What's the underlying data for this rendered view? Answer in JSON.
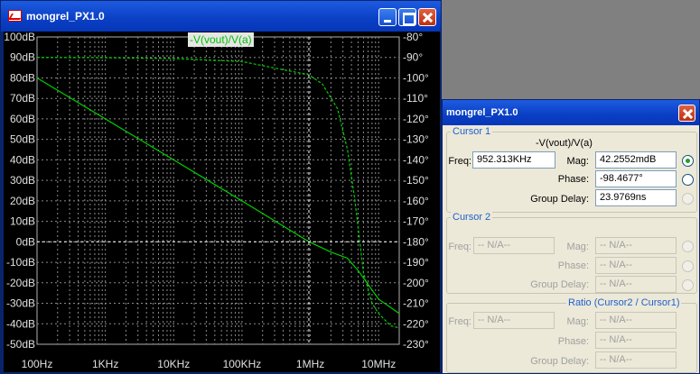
{
  "plot_window": {
    "title": "mongrel_PX1.0",
    "trace_label": "-V(vout)/V(a)"
  },
  "chart_data": {
    "type": "line",
    "x_scale": "log",
    "x_range_hz": [
      100,
      20000000
    ],
    "x_ticks": [
      "100Hz",
      "1KHz",
      "10KHz",
      "100KHz",
      "1MHz",
      "10MHz"
    ],
    "y_left_label_ticks": [
      "100dB",
      "90dB",
      "80dB",
      "70dB",
      "60dB",
      "50dB",
      "40dB",
      "30dB",
      "20dB",
      "10dB",
      "0dB",
      "-10dB",
      "-20dB",
      "-30dB",
      "-40dB",
      "-50dB"
    ],
    "y_left_range_db": [
      -50,
      100
    ],
    "y_right_label_ticks": [
      "-80°",
      "-90°",
      "-100°",
      "-110°",
      "-120°",
      "-130°",
      "-140°",
      "-150°",
      "-160°",
      "-170°",
      "-180°",
      "-190°",
      "-200°",
      "-210°",
      "-220°",
      "-230°"
    ],
    "y_right_range_deg": [
      -230,
      -80
    ],
    "grid": true,
    "trace_color": "#00d000",
    "series": [
      {
        "name": "-V(vout)/V(a)",
        "axis": "magnitude_db",
        "style": "solid",
        "x": [
          100,
          1000,
          10000,
          100000,
          952313,
          2000000,
          3500000,
          5000000,
          10000000,
          20000000
        ],
        "y": [
          80,
          60,
          40,
          20,
          0.042,
          -5,
          -8,
          -14,
          -28,
          -35
        ]
      },
      {
        "name": "-V(vout)/V(a)",
        "axis": "phase_deg",
        "style": "dashed",
        "x": [
          100,
          1000,
          10000,
          100000,
          952313,
          1500000,
          2500000,
          3500000,
          4500000,
          6000000,
          8000000,
          10000000,
          15000000,
          20000000
        ],
        "y": [
          -90,
          -90.1,
          -90.5,
          -92,
          -98.47,
          -103,
          -115,
          -135,
          -160,
          -195,
          -210,
          -215,
          -221,
          -222
        ]
      }
    ],
    "cursor": {
      "x": 952313,
      "mag_db": 0.042,
      "phase_deg": -98.47
    }
  },
  "cursor_window": {
    "title": "mongrel_PX1.0",
    "cursor1": {
      "legend": "Cursor 1",
      "trace": "-V(vout)/V(a)",
      "freq_label": "Freq:",
      "freq": "952.313KHz",
      "mag_label": "Mag:",
      "mag": "42.2552mdB",
      "phase_label": "Phase:",
      "phase": "-98.4677°",
      "gd_label": "Group Delay:",
      "gd": "23.9769ns"
    },
    "cursor2": {
      "legend": "Cursor 2",
      "freq_label": "Freq:",
      "freq": "-- N/A--",
      "mag_label": "Mag:",
      "mag": "-- N/A--",
      "phase_label": "Phase:",
      "phase": "-- N/A--",
      "gd_label": "Group Delay:",
      "gd": "-- N/A--"
    },
    "ratio": {
      "legend": "Ratio (Cursor2 / Cursor1)",
      "freq_label": "Freq:",
      "freq": "-- N/A--",
      "mag_label": "Mag:",
      "mag": "-- N/A--",
      "phase_label": "Phase:",
      "phase": "-- N/A--",
      "gd_label": "Group Delay:",
      "gd": "-- N/A--"
    }
  }
}
